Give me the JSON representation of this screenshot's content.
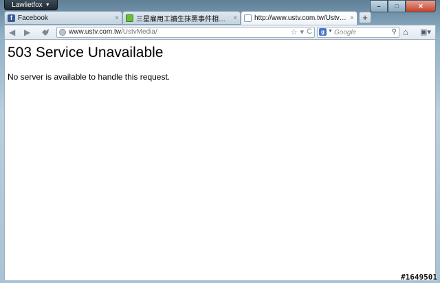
{
  "window": {
    "app_button_label": "Lawlietfox",
    "minimize_glyph": "–",
    "maximize_glyph": "□",
    "close_glyph": "✕"
  },
  "tabs": [
    {
      "label": "Facebook",
      "icon": "facebook-icon",
      "favicon_letter": "f",
      "active": false
    },
    {
      "label": "三星雇用工讀生抹黑事件相關新聞還...",
      "icon": "news-icon",
      "active": false
    },
    {
      "label": "http://www.ustv.com.tw/UstvMedia/",
      "icon": "blank-page-icon",
      "active": true
    }
  ],
  "tab_close_glyph": "×",
  "new_tab_glyph": "+",
  "navbar": {
    "back_glyph": "◀",
    "forward_glyph": "▶",
    "url_host": "www.ustv.com.tw",
    "url_path": "/UstvMedia/",
    "star_glyph": "☆",
    "dropdown_glyph": "▾",
    "reload_glyph": "C",
    "search_engine_letter": "g",
    "search_placeholder": "Google",
    "search_go_glyph": "⚲",
    "home_glyph": "⌂",
    "menu_glyph": "▣▾"
  },
  "page": {
    "title": "503 Service Unavailable",
    "message": "No server is available to handle this request."
  },
  "watermark": "#1649501",
  "colors": {
    "facebook": "#3b5998",
    "news_favicon": "#6abf3a",
    "close_button": "#c4412b"
  }
}
